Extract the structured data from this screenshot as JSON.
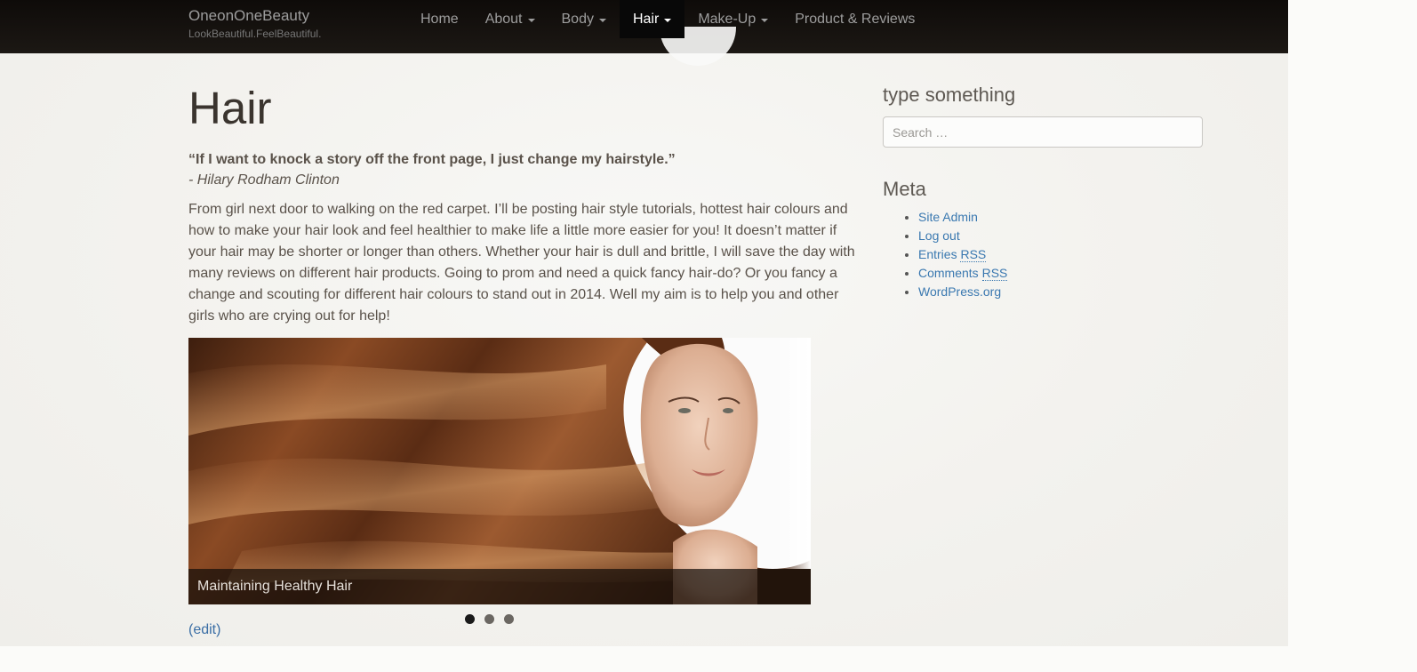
{
  "brand": {
    "title": "OneonOneBeauty",
    "tagline": "LookBeautiful.FeelBeautiful."
  },
  "nav": {
    "items": [
      {
        "label": "Home",
        "dropdown": false,
        "active": false
      },
      {
        "label": "About",
        "dropdown": true,
        "active": false
      },
      {
        "label": "Body",
        "dropdown": true,
        "active": false
      },
      {
        "label": "Hair",
        "dropdown": true,
        "active": true
      },
      {
        "label": "Make-Up",
        "dropdown": true,
        "active": false
      },
      {
        "label": "Product & Reviews",
        "dropdown": false,
        "active": false
      }
    ]
  },
  "main": {
    "title": "Hair",
    "quote": "“If I want to knock a story off the front page, I just change my hairstyle.”",
    "quote_author": "- Hilary Rodham Clinton",
    "intro": "From girl next door to walking on the red carpet. I’ll be posting hair style tutorials, hottest hair colours and how to make your hair look and feel healthier to make life a little more easier for you! It doesn’t matter if your hair may be shorter or longer than others. Whether your hair is dull and brittle, I will save the day with many reviews on different hair products. Going to prom and need a quick fancy hair-do? Or you fancy a change and scouting for different hair colours to stand out in 2014. Well my aim is to help you and other girls who are crying out for help!",
    "slider": {
      "caption": "Maintaining Healthy Hair",
      "slide_count": 3,
      "active_slide": 1
    },
    "edit_label": "(edit)"
  },
  "sidebar": {
    "search": {
      "title": "type something",
      "placeholder": "Search …"
    },
    "meta": {
      "title": "Meta",
      "links": [
        {
          "text": "Site Admin",
          "abbr": ""
        },
        {
          "text": "Log out",
          "abbr": ""
        },
        {
          "text": "Entries",
          "abbr": "RSS"
        },
        {
          "text": "Comments",
          "abbr": "RSS"
        },
        {
          "text": "WordPress.org",
          "abbr": ""
        }
      ]
    }
  },
  "colors": {
    "navbar": "#1a1612",
    "link": "#3a78b0",
    "text": "#5a524a"
  }
}
